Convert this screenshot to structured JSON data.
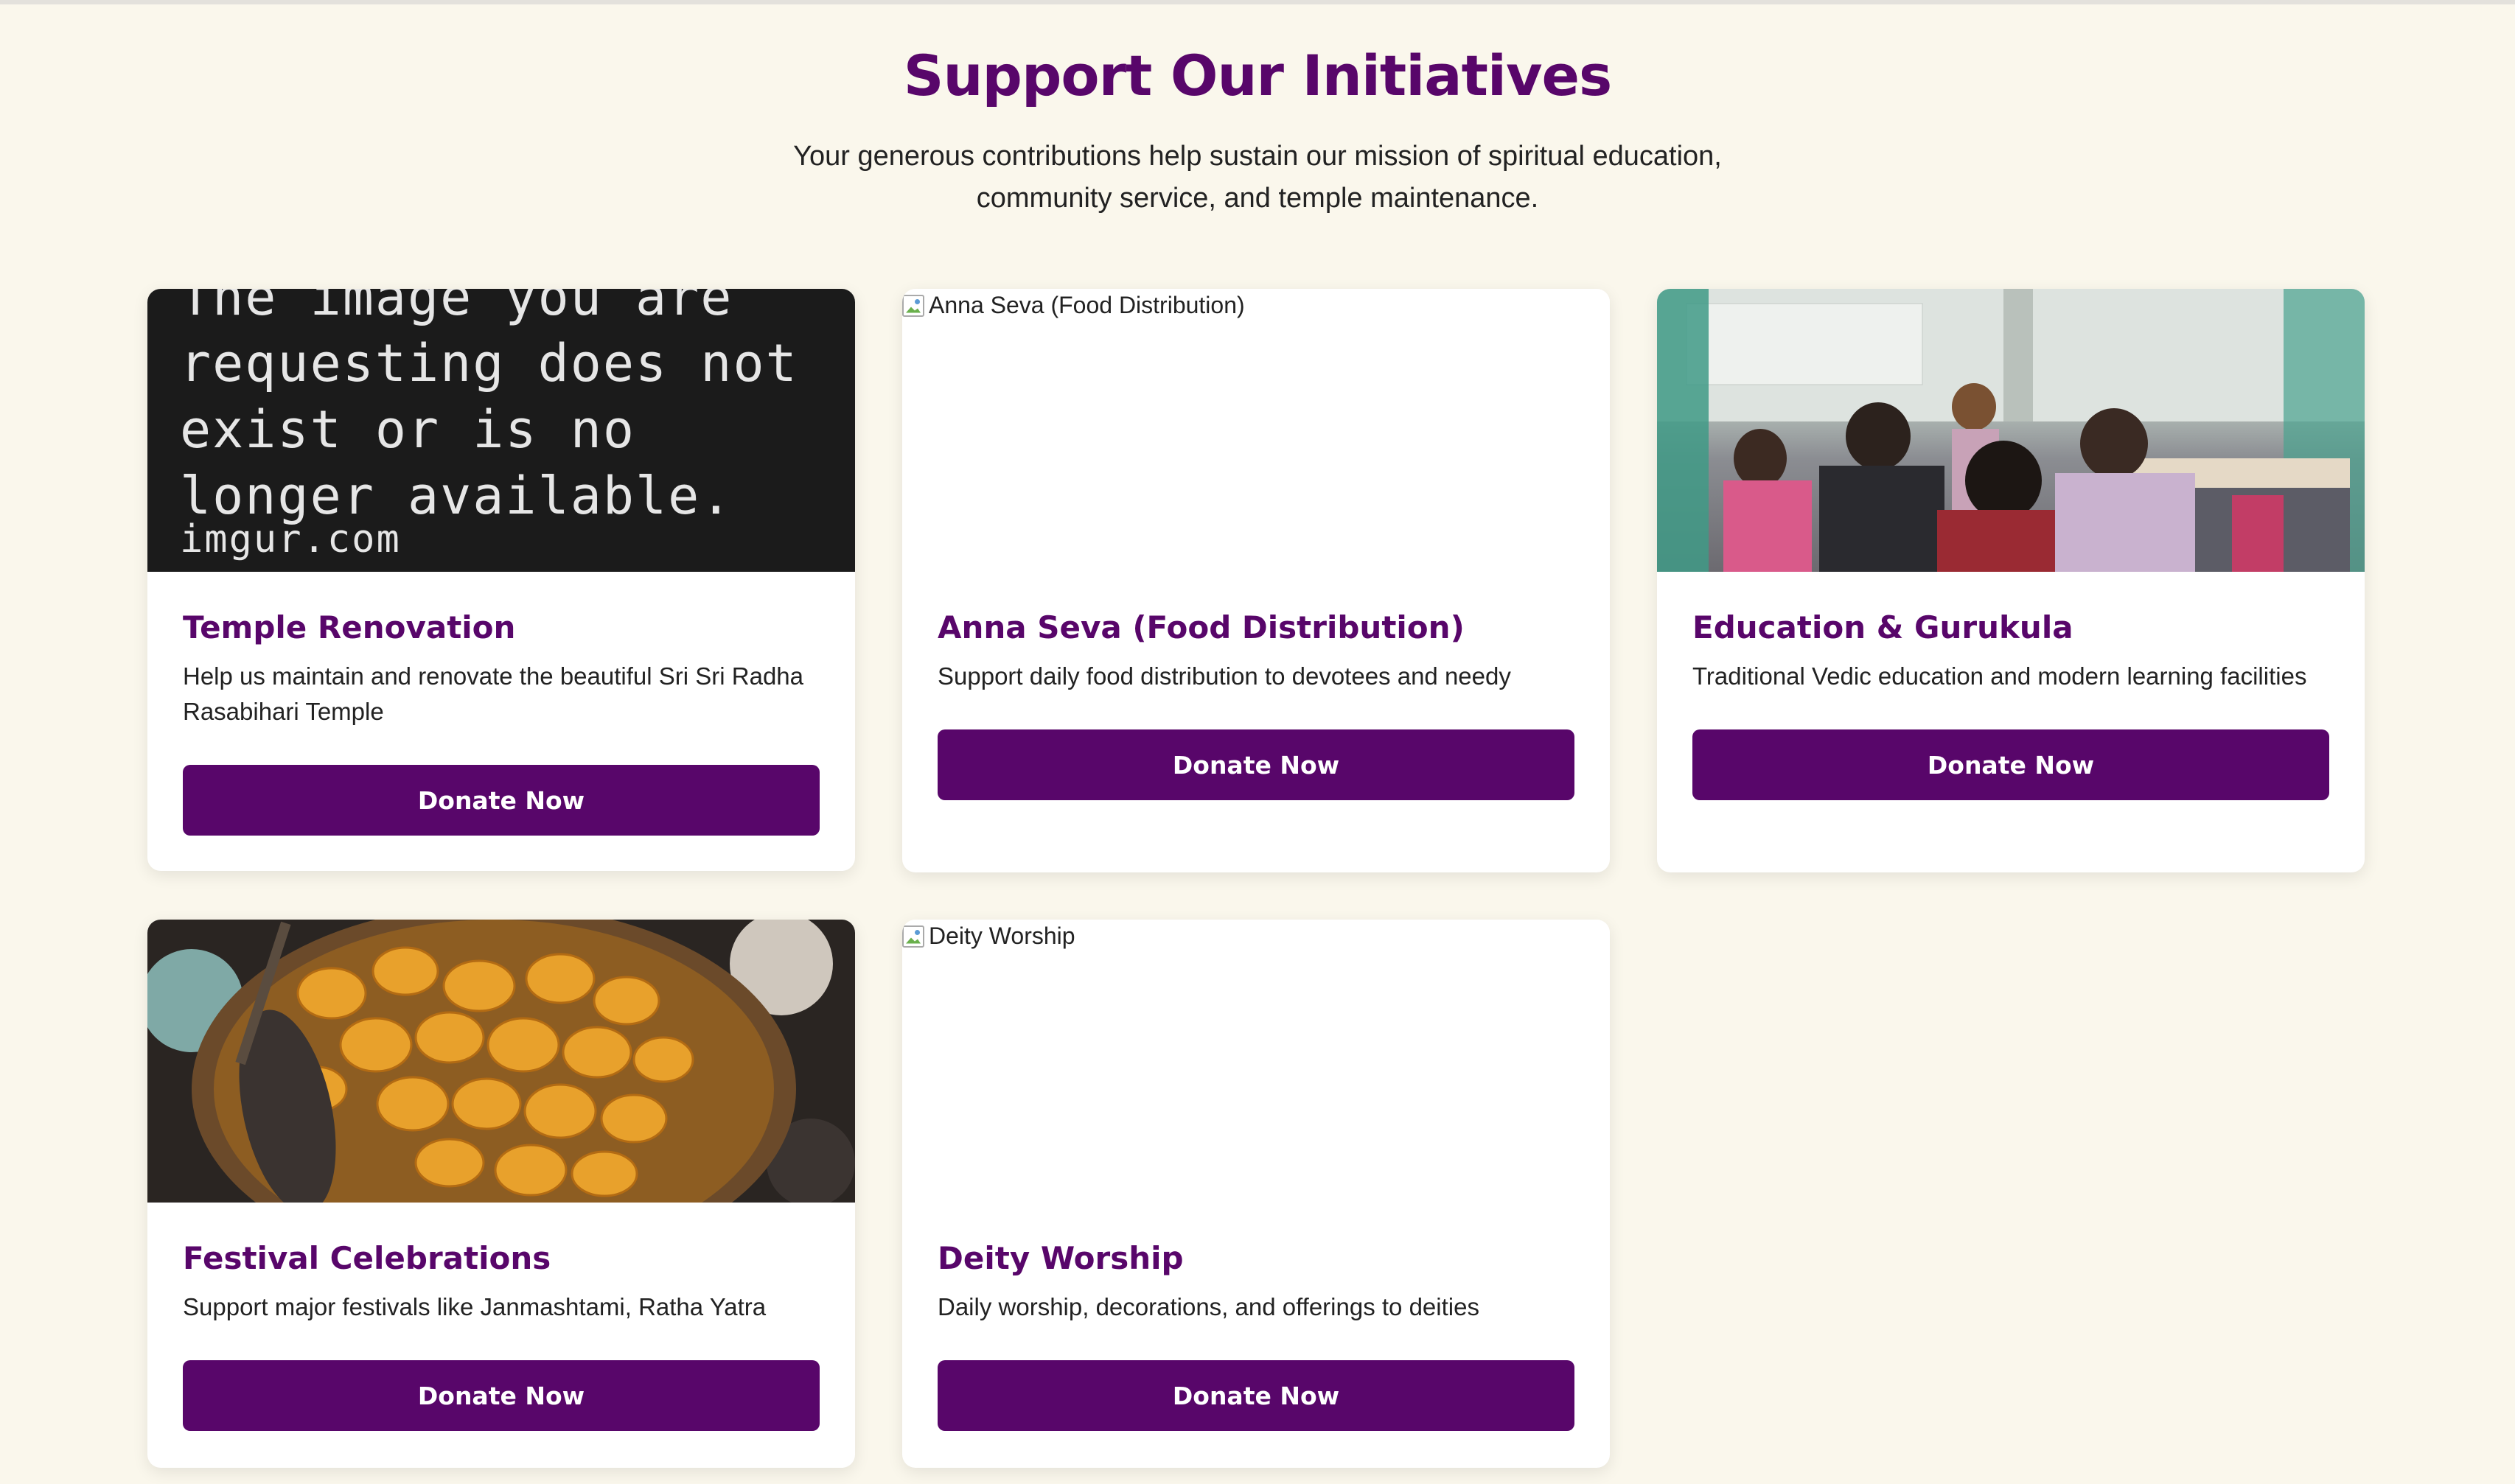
{
  "header": {
    "title": "Support Our Initiatives",
    "subtitle": "Your generous contributions help sustain our mission of spiritual education, community service, and temple maintenance."
  },
  "cards": [
    {
      "title": "Temple Renovation",
      "description": "Help us maintain and renovate the beautiful Sri Sri Radha Rasabihari Temple",
      "button": "Donate Now",
      "image_text": "The image you are requesting does not exist or is no longer available.",
      "image_source": "imgur.com"
    },
    {
      "title": "Anna Seva (Food Distribution)",
      "description": "Support daily food distribution to devotees and needy",
      "button": "Donate Now",
      "image_alt": "Anna Seva (Food Distribution)"
    },
    {
      "title": "Education & Gurukula",
      "description": "Traditional Vedic education and modern learning facilities",
      "button": "Donate Now"
    },
    {
      "title": "Festival Celebrations",
      "description": "Support major festivals like Janmashtami, Ratha Yatra",
      "button": "Donate Now"
    },
    {
      "title": "Deity Worship",
      "description": "Daily worship, decorations, and offerings to deities",
      "button": "Donate Now",
      "image_alt": "Deity Worship"
    }
  ],
  "colors": {
    "accent": "#58066a",
    "page_background": "#faf7ec",
    "card_background": "#ffffff"
  }
}
